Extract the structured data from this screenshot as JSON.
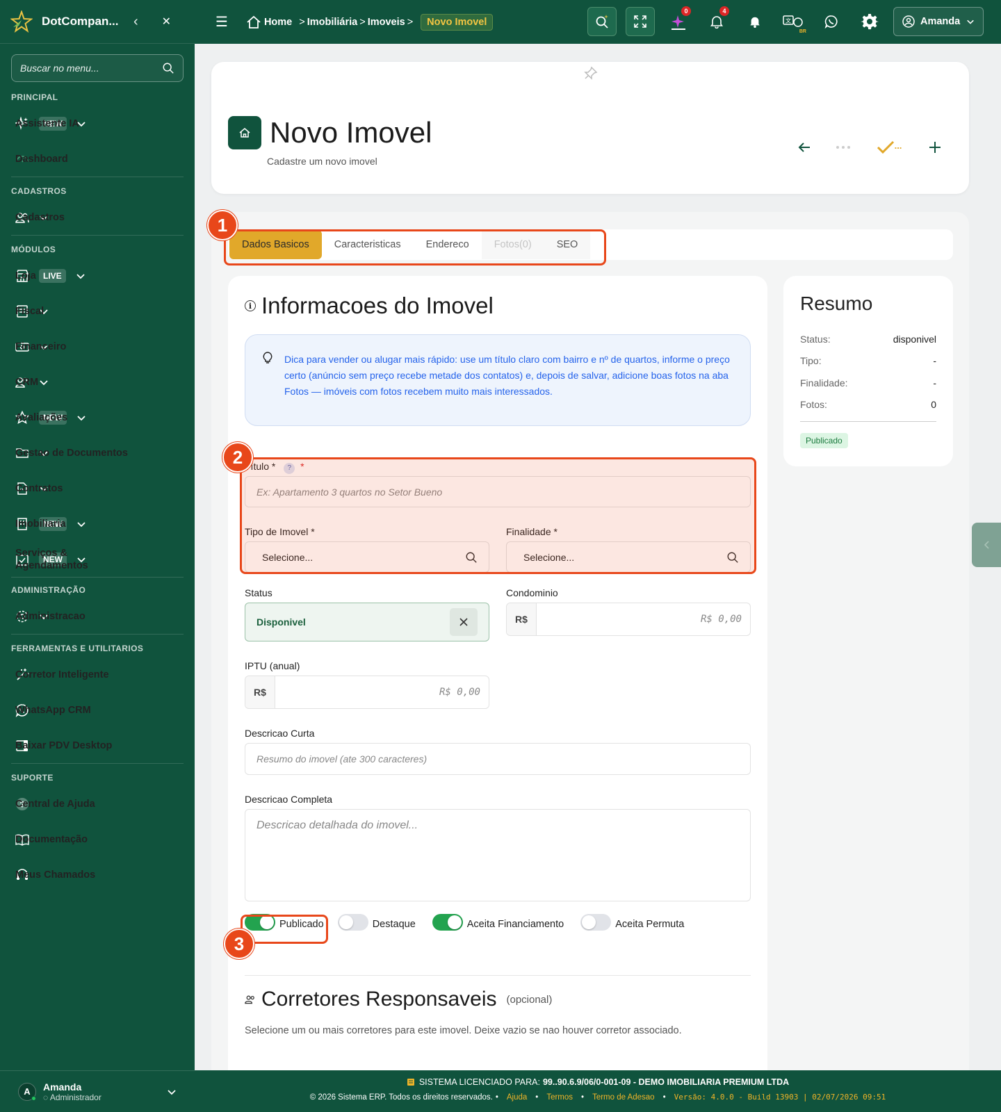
{
  "app": {
    "brand": "DotCompan..."
  },
  "sidebar": {
    "search_placeholder": "Buscar no menu...",
    "sections": {
      "principal": "PRINCIPAL",
      "cadastros": "CADASTROS",
      "modulos": "MÓDULOS",
      "administracao": "ADMINISTRAÇÃO",
      "ferramentas": "FERRAMENTAS E UTILITARIOS",
      "suporte": "SUPORTE"
    },
    "items": {
      "assistente": {
        "label": "Assistente IA",
        "badge": "NEW"
      },
      "dashboard": {
        "label": "Dashboard"
      },
      "cadastros": {
        "label": "Cadastros"
      },
      "loja": {
        "label": "Loja",
        "badge": "LIVE"
      },
      "fiscal": {
        "label": "Fiscal"
      },
      "financeiro": {
        "label": "Financeiro"
      },
      "crm": {
        "label": "CRM"
      },
      "avaliacoes": {
        "label": "Avaliações",
        "badge": "NEW"
      },
      "documentos": {
        "label": "Gestao de Documentos"
      },
      "contratos": {
        "label": "Contratos"
      },
      "imobiliaria": {
        "label": "Imobiliaria",
        "badge": "NEW"
      },
      "servicos": {
        "label": "Serviços & Agendamentos",
        "badge": "NEW"
      },
      "administracao": {
        "label": "Administracao"
      },
      "corretor": {
        "label": "Corretor Inteligente"
      },
      "whatsapp": {
        "label": "WhatsApp CRM"
      },
      "pdv": {
        "label": "Baixar PDV Desktop"
      },
      "ajuda": {
        "label": "Central de Ajuda"
      },
      "documentacao": {
        "label": "Documentação"
      },
      "chamados": {
        "label": "Meus Chamados"
      }
    },
    "user": {
      "initial": "A",
      "name": "Amanda",
      "role": "Administrador"
    }
  },
  "topbar": {
    "breadcrumb": {
      "home": "Home",
      "sep": ">",
      "l1": "Imobiliária",
      "l2": "Imoveis",
      "current": "Novo Imovel"
    },
    "notifications": {
      "ai": "0",
      "bell": "4"
    },
    "lang": "BR",
    "user": "Amanda"
  },
  "header": {
    "title": "Novo Imovel",
    "subtitle": "Cadastre um novo imovel",
    "save_dots": "..."
  },
  "tabs": [
    "Dados Basicos",
    "Caracteristicas",
    "Endereco",
    "Fotos(0)",
    "SEO"
  ],
  "form": {
    "section_title": "Informacoes do Imovel",
    "tip": "Dica para vender ou alugar mais rápido: use um título claro com bairro e nº de quartos, informe o preço certo (anúncio sem preço recebe metade dos contatos) e, depois de salvar, adicione boas fotos na aba Fotos — imóveis com fotos recebem muito mais interessados.",
    "titulo": {
      "label": "Título *",
      "help": "?",
      "req": "*",
      "placeholder": "Ex: Apartamento 3 quartos no Setor Bueno"
    },
    "tipo": {
      "label": "Tipo de Imovel *",
      "value": "Selecione..."
    },
    "finalidade": {
      "label": "Finalidade *",
      "value": "Selecione..."
    },
    "status": {
      "label": "Status",
      "value": "Disponivel"
    },
    "condominio": {
      "label": "Condominio",
      "prefix": "R$",
      "placeholder": "R$ 0,00"
    },
    "iptu": {
      "label": "IPTU (anual)",
      "prefix": "R$",
      "placeholder": "R$ 0,00"
    },
    "desc_curta": {
      "label": "Descricao Curta",
      "placeholder": "Resumo do imovel (ate 300 caracteres)"
    },
    "desc_completa": {
      "label": "Descricao Completa",
      "placeholder": "Descricao detalhada do imovel..."
    },
    "toggles": [
      {
        "label": "Publicado",
        "on": true
      },
      {
        "label": "Destaque",
        "on": false
      },
      {
        "label": "Aceita Financiamento",
        "on": true
      },
      {
        "label": "Aceita Permuta",
        "on": false
      }
    ],
    "corretores": {
      "title": "Corretores Responsaveis",
      "optional": "(opcional)",
      "hint": "Selecione um ou mais corretores para este imovel. Deixe vazio se nao houver corretor associado."
    }
  },
  "summary": {
    "title": "Resumo",
    "rows": [
      {
        "k": "Status:",
        "v": "disponivel"
      },
      {
        "k": "Tipo:",
        "v": "-"
      },
      {
        "k": "Finalidade:",
        "v": "-"
      },
      {
        "k": "Fotos:",
        "v": "0"
      }
    ],
    "pill": "Publicado"
  },
  "annotations": [
    "1",
    "2",
    "3"
  ],
  "footer": {
    "license_label": "SISTEMA LICENCIADO PARA:",
    "license_value": "99..90.6.9/06/0-001-09 - DEMO IMOBILIARIA PREMIUM LTDA",
    "copyright": "© 2026 Sistema ERP. Todos os direitos reservados.",
    "links": [
      "Ajuda",
      "Termos",
      "Termo de Adesao"
    ],
    "version": "Versão: 4.0.0 - Build 13903 | 02/07/2026 09:51"
  },
  "colors": {
    "primary": "#10533d",
    "accent": "#e1a82a",
    "annotation": "#e8471a"
  }
}
